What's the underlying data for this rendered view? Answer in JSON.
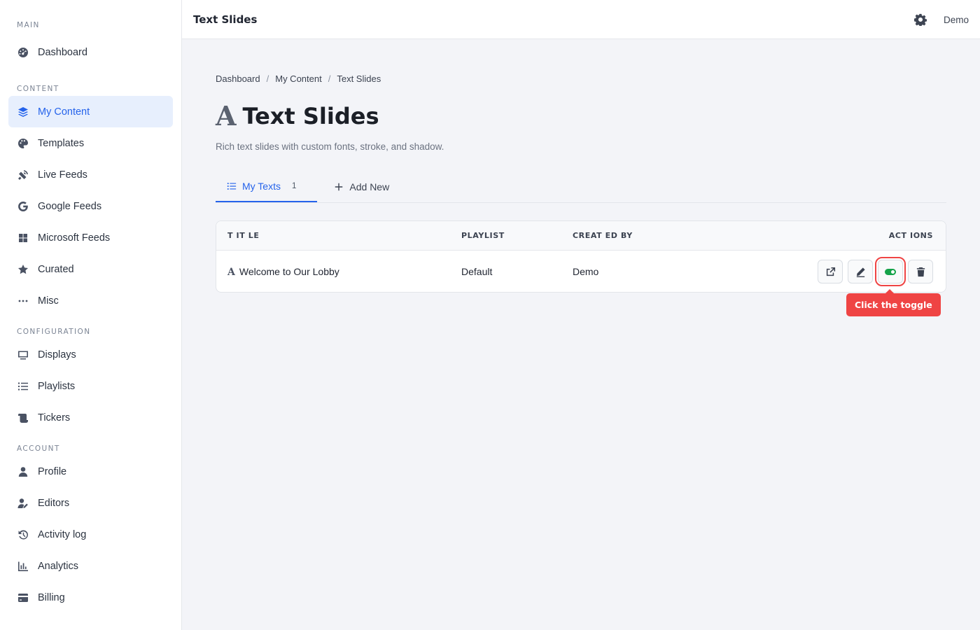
{
  "sidebar": {
    "sections": [
      {
        "label": "MAIN",
        "items": [
          {
            "label": "Dashboard",
            "icon": "gauge-icon"
          }
        ]
      },
      {
        "label": "CONTENT",
        "items": [
          {
            "label": "My Content",
            "icon": "layers-icon",
            "active": true
          },
          {
            "label": "Templates",
            "icon": "palette-icon"
          },
          {
            "label": "Live Feeds",
            "icon": "satellite-icon"
          },
          {
            "label": "Google Feeds",
            "icon": "google-icon"
          },
          {
            "label": "Microsoft Feeds",
            "icon": "windows-icon"
          },
          {
            "label": "Curated",
            "icon": "star-icon"
          },
          {
            "label": "Misc",
            "icon": "ellipsis-icon"
          }
        ]
      },
      {
        "label": "CONFIGURATION",
        "items": [
          {
            "label": "Displays",
            "icon": "monitor-icon"
          },
          {
            "label": "Playlists",
            "icon": "list-icon"
          },
          {
            "label": "Tickers",
            "icon": "scroll-icon"
          }
        ]
      },
      {
        "label": "ACCOUNT",
        "items": [
          {
            "label": "Profile",
            "icon": "user-icon"
          },
          {
            "label": "Editors",
            "icon": "user-edit-icon"
          },
          {
            "label": "Activity log",
            "icon": "history-icon"
          },
          {
            "label": "Analytics",
            "icon": "chart-icon"
          },
          {
            "label": "Billing",
            "icon": "credit-card-icon"
          }
        ]
      }
    ]
  },
  "topbar": {
    "title": "Text Slides",
    "user": "Demo"
  },
  "breadcrumb": [
    "Dashboard",
    "My Content",
    "Text Slides"
  ],
  "page": {
    "title_glyph": "A",
    "title": "Text Slides",
    "subtitle": "Rich text slides with custom fonts, stroke, and shadow."
  },
  "tabs": [
    {
      "label": "My Texts",
      "count": "1",
      "active": true
    },
    {
      "label": "Add New"
    }
  ],
  "table": {
    "headers": {
      "title": "T IT LE",
      "playlist": "PLAYLIST",
      "created_by": "CREAT ED BY",
      "actions": "ACT IONS"
    },
    "rows": [
      {
        "glyph": "A",
        "title": "Welcome to Our Lobby",
        "playlist": "Default",
        "created_by": "Demo"
      }
    ]
  },
  "tooltip": {
    "text": "Click the toggle"
  },
  "colors": {
    "accent": "#2563eb",
    "toggle_on": "#16a34a",
    "highlight": "#ef4444"
  }
}
